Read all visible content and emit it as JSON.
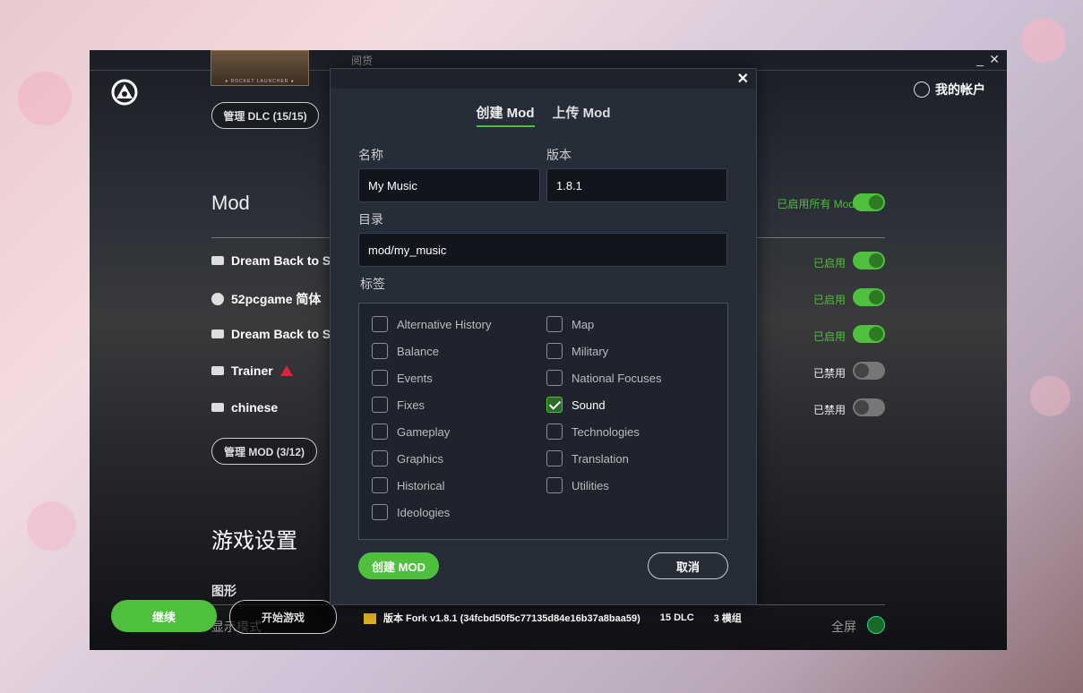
{
  "window": {
    "minimize": "_",
    "close": "✕"
  },
  "header": {
    "account": "我的帐户",
    "menu_partial": "阅货",
    "rocket_caption": "● ROCKET LAUNCHER ●"
  },
  "dlc": {
    "manage_label": "管理 DLC (15/15)"
  },
  "mods": {
    "title": "Mod",
    "enable_all": "已启用所有 Mod",
    "items": [
      {
        "name": "Dream Back to S",
        "status": "已启用",
        "enabled": true,
        "icon": "drive-icon"
      },
      {
        "name": "52pcgame 简体",
        "status": "已启用",
        "enabled": true,
        "icon": "steam-icon"
      },
      {
        "name": "Dream Back to S",
        "status": "已启用",
        "enabled": true,
        "icon": "drive-icon"
      },
      {
        "name": "Trainer",
        "status": "已禁用",
        "enabled": false,
        "icon": "drive-icon",
        "warning": true
      },
      {
        "name": "chinese",
        "status": "已禁用",
        "enabled": false,
        "icon": "drive-icon"
      }
    ],
    "manage_label": "管理 MOD (3/12)"
  },
  "settings": {
    "title": "游戏设置",
    "graphics": "图形",
    "display_mode": "显示模式",
    "fullscreen": "全屏"
  },
  "footer": {
    "continue": "继续",
    "start_new": "开始游戏",
    "version": "版本 Fork v1.8.1 (34fcbd50f5c77135d84e16b37a8baa59)",
    "dlc_count": "15 DLC",
    "mod_count": "3 模组"
  },
  "dialog": {
    "close": "✕",
    "tabs": [
      {
        "label": "创建 Mod",
        "active": true
      },
      {
        "label": "上传 Mod",
        "active": false
      }
    ],
    "name_label": "名称",
    "name_value": "My Music",
    "version_label": "版本",
    "version_value": "1.8.1",
    "dir_label": "目录",
    "dir_value": "mod/my_music",
    "tags_label": "标签",
    "tags_left": [
      {
        "label": "Alternative History",
        "checked": false
      },
      {
        "label": "Balance",
        "checked": false
      },
      {
        "label": "Events",
        "checked": false
      },
      {
        "label": "Fixes",
        "checked": false
      },
      {
        "label": "Gameplay",
        "checked": false
      },
      {
        "label": "Graphics",
        "checked": false
      },
      {
        "label": "Historical",
        "checked": false
      },
      {
        "label": "Ideologies",
        "checked": false
      }
    ],
    "tags_right": [
      {
        "label": "Map",
        "checked": false
      },
      {
        "label": "Military",
        "checked": false
      },
      {
        "label": "National Focuses",
        "checked": false
      },
      {
        "label": "Sound",
        "checked": true
      },
      {
        "label": "Technologies",
        "checked": false
      },
      {
        "label": "Translation",
        "checked": false
      },
      {
        "label": "Utilities",
        "checked": false
      }
    ],
    "create_label": "创建 MOD",
    "cancel_label": "取消"
  },
  "colors": {
    "accent": "#4fbf3e",
    "danger": "#e02040",
    "dialog_bg": "#262c38"
  }
}
